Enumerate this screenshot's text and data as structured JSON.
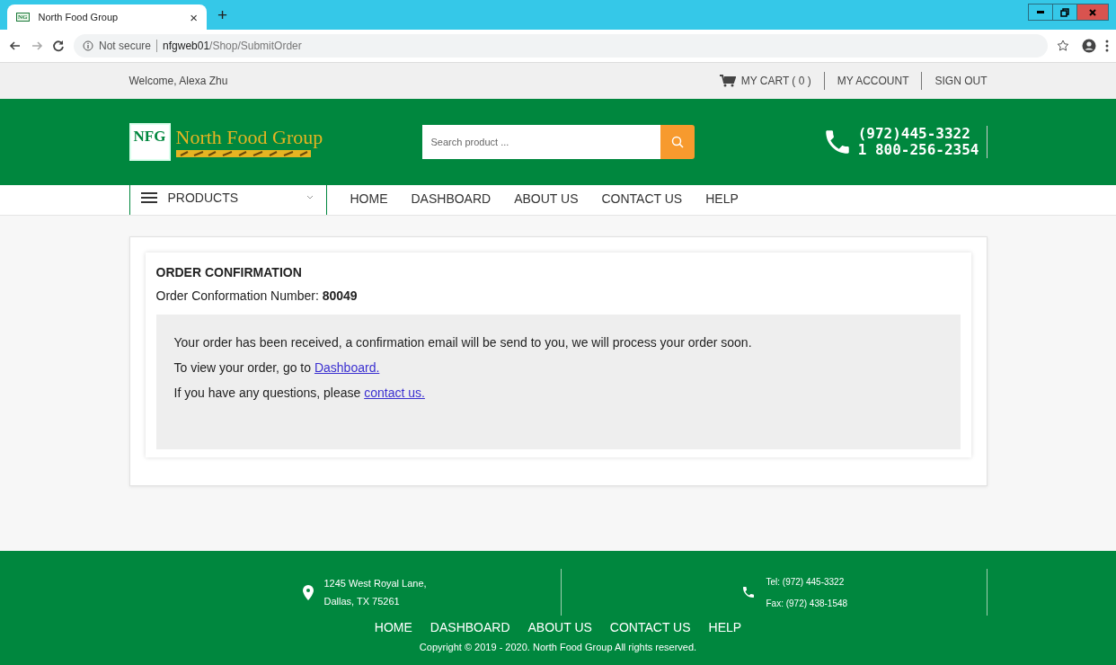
{
  "browser": {
    "tab": {
      "favicon": "NG",
      "title": "North Food Group",
      "close": "×",
      "selected": true
    },
    "new_tab": "+",
    "security": "Not secure",
    "url_host": "nfgweb01",
    "url_path": "/Shop/SubmitOrder"
  },
  "top_bar": {
    "welcome": "Welcome, Alexa Zhu",
    "links": [
      {
        "kind": "cart",
        "label": "MY CART ( 0 )"
      },
      {
        "kind": "plain",
        "label": "MY ACCOUNT"
      },
      {
        "kind": "plain",
        "label": "SIGN OUT"
      }
    ]
  },
  "header": {
    "logo_mark": "NFG",
    "logo_text": "North Food Group",
    "search": {
      "placeholder": "Search product ..."
    },
    "phones": [
      "(972)445-3322",
      "1 800-256-2354"
    ]
  },
  "nav": {
    "products": "PRODUCTS",
    "items": [
      "HOME",
      "DASHBOARD",
      "ABOUT US",
      "CONTACT US",
      "HELP"
    ]
  },
  "confirmation": {
    "title": "ORDER CONFIRMATION",
    "number_label": "Order Conformation Number: ",
    "number": "80049",
    "lines": [
      {
        "text": "Your order has been received, a confirmation email will be send to you, we will process your order soon."
      },
      {
        "text": "To view your order, go to ",
        "link": "Dashboard."
      },
      {
        "text": "If you have any questions, please ",
        "link": "contact us."
      }
    ]
  },
  "footer": {
    "address": [
      "1245 West Royal Lane,",
      "Dallas, TX 75261"
    ],
    "contact": [
      "Tel: (972) 445-3322",
      "Fax: (972) 438-1548"
    ],
    "nav": [
      "HOME",
      "DASHBOARD",
      "ABOUT US",
      "CONTACT US",
      "HELP"
    ],
    "copyright": "Copyright © 2019 - 2020. North Food Group All rights reserved."
  }
}
